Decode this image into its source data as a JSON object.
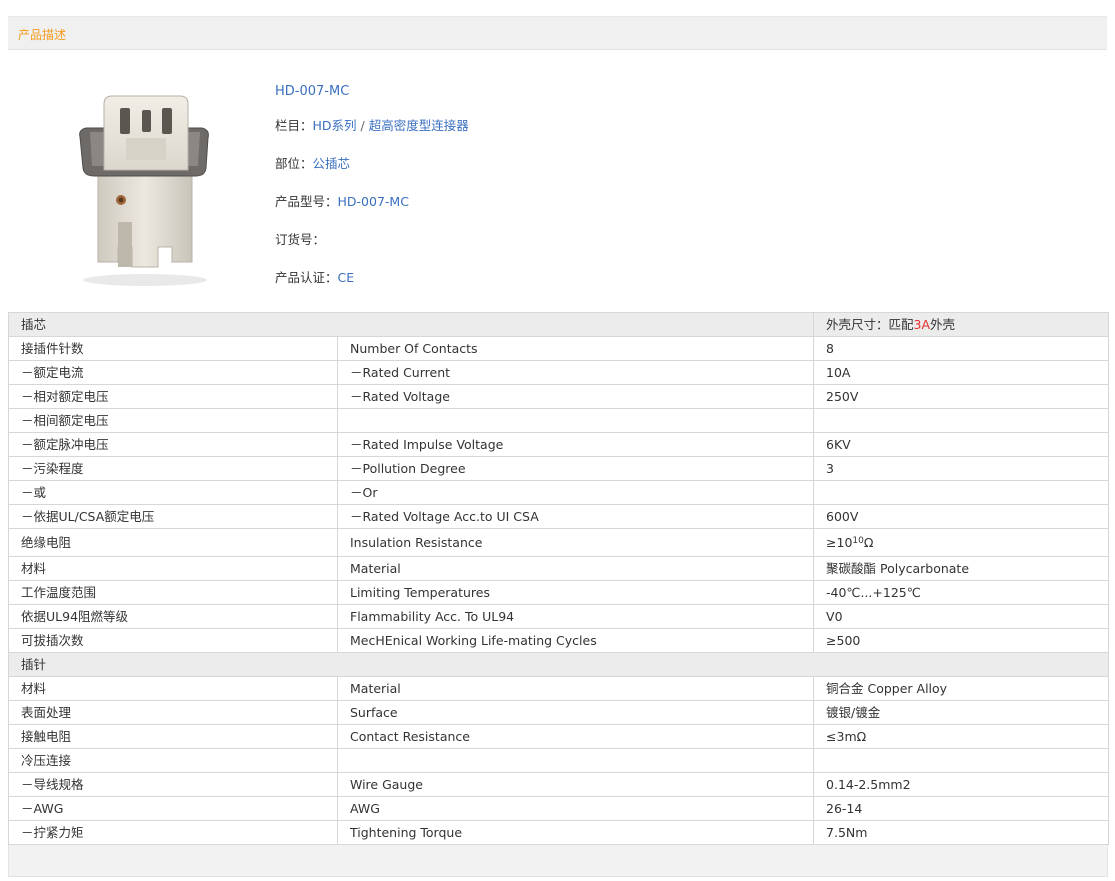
{
  "section": {
    "title": "产品描述"
  },
  "product": {
    "name": "HD-007-MC",
    "category_label": "栏目：",
    "category_1": "HD系列",
    "category_sep": "/",
    "category_2": "超高密度型连接器",
    "part_label": "部位：",
    "part_value": "公插芯",
    "model_label": "产品型号：",
    "model_value": "HD-007-MC",
    "order_label": "订货号：",
    "order_value": "",
    "cert_label": "产品认证：",
    "cert_value": "CE"
  },
  "spec": {
    "insert_header": "插芯",
    "housing_label_pre": "外壳尺寸：匹配",
    "housing_label_hl": "3A",
    "housing_label_post": "外壳",
    "insert_rows": [
      {
        "cn": "接插件针数",
        "en": "Number Of Contacts",
        "val": "8"
      },
      {
        "cn": "－额定电流",
        "en": "－Rated Current",
        "val": "10A"
      },
      {
        "cn": "－相对额定电压",
        "en": "－Rated Voltage",
        "val": "250V"
      },
      {
        "cn": "－相间额定电压",
        "en": "",
        "val": ""
      },
      {
        "cn": "－额定脉冲电压",
        "en": "－Rated Impulse Voltage",
        "val": "6KV"
      },
      {
        "cn": "－污染程度",
        "en": "－Pollution Degree",
        "val": "3"
      },
      {
        "cn": "－或",
        "en": "－Or",
        "val": ""
      },
      {
        "cn": "－依据UL/CSA额定电压",
        "en": "－Rated Voltage Acc.to UI CSA",
        "val": "600V"
      }
    ],
    "insulation": {
      "cn": "绝缘电阻",
      "en": "Insulation Resistance",
      "val_base": "≥10",
      "val_exp": "10",
      "val_unit": "Ω"
    },
    "insert_rows_2": [
      {
        "cn": "材料",
        "en": "Material",
        "val": "聚碳酸酯 Polycarbonate"
      },
      {
        "cn": "工作温度范围",
        "en": "Limiting Temperatures",
        "val": "-40℃...+125℃"
      },
      {
        "cn": "依据UL94阻燃等级",
        "en": "Flammability Acc. To UL94",
        "val": "V0"
      },
      {
        "cn": "可拔插次数",
        "en": "MecHEnical Working Life-mating Cycles",
        "val": "≥500"
      }
    ],
    "pin_header": "插针",
    "pin_rows": [
      {
        "cn": "材料",
        "en": "Material",
        "val": "铜合金 Copper Alloy"
      },
      {
        "cn": "表面处理",
        "en": "Surface",
        "val": "镀银/镀金"
      },
      {
        "cn": "接触电阻",
        "en": "Contact Resistance",
        "val": "≤3mΩ"
      },
      {
        "cn": "冷压连接",
        "en": "",
        "val": ""
      },
      {
        "cn": "－导线规格",
        "en": "Wire Gauge",
        "val": "0.14-2.5mm2"
      },
      {
        "cn": "－AWG",
        "en": "AWG",
        "val": "26-14"
      },
      {
        "cn": "－拧紧力矩",
        "en": "Tightening Torque",
        "val": "7.5Nm"
      }
    ]
  },
  "colors": {
    "accent_orange": "#f49b1c",
    "link_blue": "#3a6fc0",
    "highlight_red": "#e2302c"
  }
}
